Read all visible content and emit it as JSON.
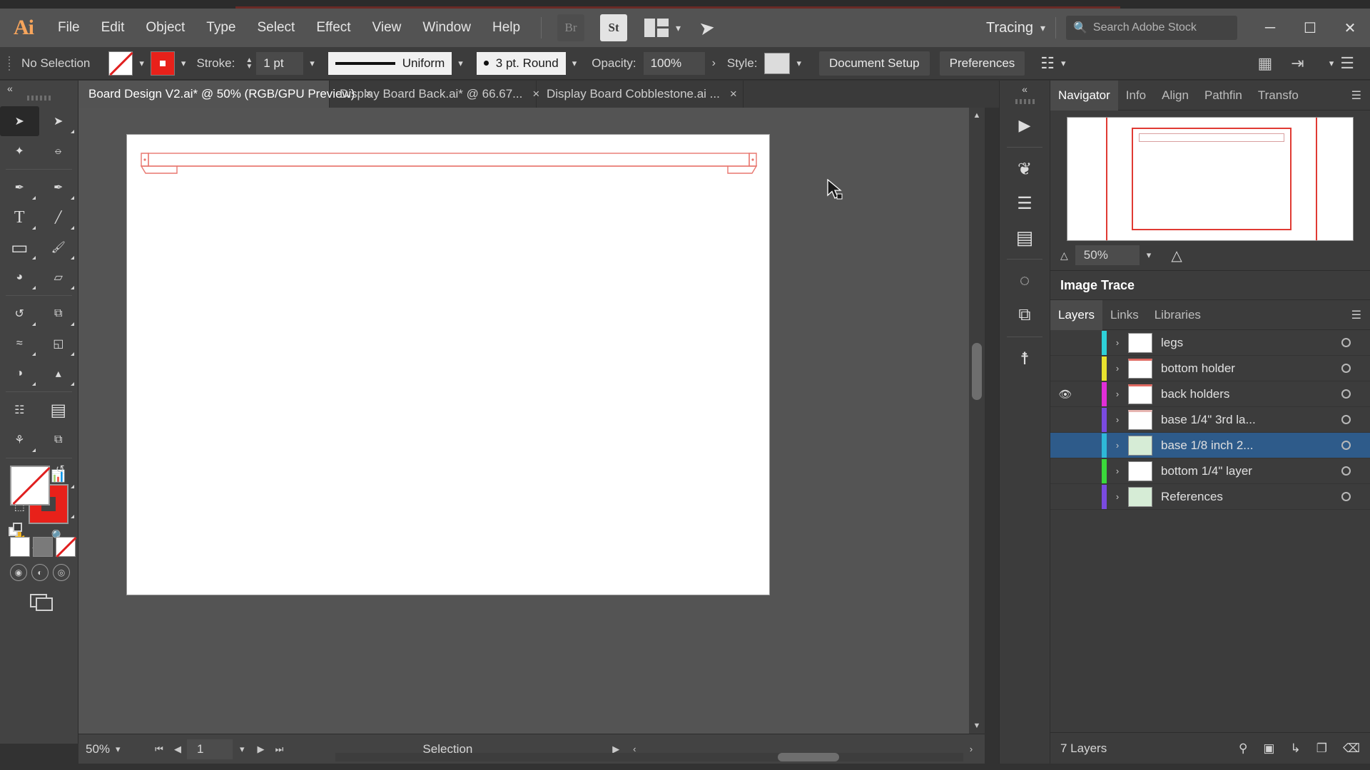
{
  "app": {
    "name": "Adobe Illustrator",
    "logo_text": "Ai"
  },
  "menubar": {
    "items": [
      {
        "label": "File"
      },
      {
        "label": "Edit"
      },
      {
        "label": "Object"
      },
      {
        "label": "Type"
      },
      {
        "label": "Select"
      },
      {
        "label": "Effect"
      },
      {
        "label": "View"
      },
      {
        "label": "Window"
      },
      {
        "label": "Help"
      }
    ],
    "bridge_label": "Br",
    "stock_label": "St",
    "arrange_icon": "arrange-documents-icon",
    "rocket_icon": "discover-rocket-icon",
    "workspace": "Tracing",
    "search_placeholder": "Search Adobe Stock",
    "search_value": "",
    "search_icon": "search-icon",
    "window_minimize": "minimize-icon",
    "window_restore": "restore-icon",
    "window_close": "close-icon"
  },
  "controlbar": {
    "selection_status": "No Selection",
    "fill_swatch": "none-swatch",
    "stroke_swatch": "red-stroke-swatch",
    "stroke_label": "Stroke:",
    "stroke_weight": "1 pt",
    "stroke_profile": "Uniform",
    "brush_definition": "3 pt. Round",
    "opacity_label": "Opacity:",
    "opacity_value": "100%",
    "style_label": "Style:",
    "document_setup": "Document Setup",
    "preferences": "Preferences",
    "align_icon": "align-icon",
    "distribute_icon": "distribute-icon",
    "transform_icon": "transform-icon",
    "arrange_icon": "arrange-objects-icon",
    "options_icon": "more-options-icon"
  },
  "tabs": [
    {
      "label": "Board Design V2.ai* @ 50% (RGB/GPU Preview)",
      "active": true,
      "close": "×"
    },
    {
      "label": "Display Board Back.ai* @ 66.67...",
      "active": false,
      "close": "×"
    },
    {
      "label": "Display Board Cobblestone.ai ...",
      "active": false,
      "close": "×"
    }
  ],
  "tools": [
    {
      "name": "selection-tool",
      "glyph": "➤",
      "active": true
    },
    {
      "name": "direct-selection-tool",
      "glyph": "➤",
      "active": false
    },
    {
      "name": "magic-wand-tool",
      "glyph": "✧",
      "active": false
    },
    {
      "name": "lasso-tool",
      "glyph": "⦵",
      "active": false
    },
    {
      "name": "pen-tool",
      "glyph": "✒",
      "active": false
    },
    {
      "name": "curvature-tool",
      "glyph": "∿",
      "active": false
    },
    {
      "name": "type-tool",
      "glyph": "T",
      "active": false
    },
    {
      "name": "line-segment-tool",
      "glyph": "╱",
      "active": false
    },
    {
      "name": "rectangle-tool",
      "glyph": "▭",
      "active": false
    },
    {
      "name": "paintbrush-tool",
      "glyph": "✐",
      "active": false
    },
    {
      "name": "shaper-tool",
      "glyph": "◔",
      "active": false
    },
    {
      "name": "eraser-tool",
      "glyph": "▱",
      "active": false
    },
    {
      "name": "rotate-tool",
      "glyph": "↺",
      "active": false
    },
    {
      "name": "scale-tool",
      "glyph": "⧉",
      "active": false
    },
    {
      "name": "width-tool",
      "glyph": "≈",
      "active": false
    },
    {
      "name": "free-transform-tool",
      "glyph": "◱",
      "active": false
    },
    {
      "name": "shape-builder-tool",
      "glyph": "◑",
      "active": false
    },
    {
      "name": "perspective-grid-tool",
      "glyph": "△",
      "active": false
    },
    {
      "name": "mesh-tool",
      "glyph": "⌗",
      "active": false
    },
    {
      "name": "gradient-tool",
      "glyph": "▤",
      "active": false
    },
    {
      "name": "eyedropper-tool",
      "glyph": "⚗",
      "active": false
    },
    {
      "name": "blend-tool",
      "glyph": "⧉",
      "active": false
    },
    {
      "name": "symbol-sprayer-tool",
      "glyph": "☃",
      "active": false
    },
    {
      "name": "column-graph-tool",
      "glyph": "█",
      "active": false
    },
    {
      "name": "artboard-tool",
      "glyph": "⬚",
      "active": false
    },
    {
      "name": "slice-tool",
      "glyph": "✂",
      "active": false
    },
    {
      "name": "hand-tool",
      "glyph": "✋",
      "active": false
    },
    {
      "name": "zoom-tool",
      "glyph": "⚲",
      "active": false
    }
  ],
  "toolpanel": {
    "collapse_icon": "«",
    "fill_proxy": "fill-color-none",
    "stroke_proxy": "stroke-color-red",
    "swap_icon": "swap-fill-stroke-icon",
    "default_icon": "default-fill-stroke-icon",
    "color_mode": "color-swatch-mode",
    "gradient_mode": "gradient-mode",
    "none_mode": "none-mode",
    "draw_normal": "draw-normal-icon",
    "draw_behind": "draw-behind-icon",
    "draw_inside": "draw-inside-icon",
    "screen_mode": "change-screen-mode-icon"
  },
  "statusbar": {
    "zoom_level": "50%",
    "first_page_icon": "⏮",
    "prev_page_icon": "◀",
    "page_value": "1",
    "next_page_icon": "▶",
    "last_page_icon": "⏭",
    "status_text": "Selection",
    "play_icon": "▶",
    "left_arrow": "‹",
    "right_arrow": "›"
  },
  "dockrail": {
    "collapse_icon": "«",
    "icons": [
      {
        "name": "properties-panel-icon",
        "glyph": "▶"
      },
      {
        "name": "brushes-panel-icon",
        "glyph": "❦"
      },
      {
        "name": "stroke-panel-icon",
        "glyph": "≡"
      },
      {
        "name": "gradient-panel-icon",
        "glyph": "▤"
      },
      {
        "name": "transparency-panel-icon",
        "glyph": "◌"
      },
      {
        "name": "pathfinder-panel-icon",
        "glyph": "⧉"
      },
      {
        "name": "image-trace-panel-icon",
        "glyph": "◨"
      }
    ]
  },
  "navigator": {
    "tabs": [
      {
        "label": "Navigator",
        "active": true
      },
      {
        "label": "Info",
        "active": false
      },
      {
        "label": "Align",
        "active": false
      },
      {
        "label": "Pathfin",
        "active": false
      },
      {
        "label": "Transfo",
        "active": false
      }
    ],
    "menu_icon": "panel-menu-icon",
    "zoom_out_icon": "zoom-out-icon",
    "zoom_value": "50%",
    "zoom_in_icon": "zoom-in-icon"
  },
  "image_trace": {
    "title": "Image Trace"
  },
  "layers_panel": {
    "tabs": [
      {
        "label": "Layers",
        "active": true
      },
      {
        "label": "Links",
        "active": false
      },
      {
        "label": "Libraries",
        "active": false
      }
    ],
    "menu_icon": "panel-menu-icon",
    "rows": [
      {
        "name": "legs",
        "color": "#2ed0d8",
        "visible": false,
        "selected": false,
        "expand": "›"
      },
      {
        "name": "bottom holder",
        "color": "#e8e22e",
        "visible": false,
        "selected": false,
        "expand": "›"
      },
      {
        "name": "back holders",
        "color": "#e22ed8",
        "visible": true,
        "selected": false,
        "expand": "›"
      },
      {
        "name": "base 1/4\" 3rd la...",
        "color": "#7a4ae0",
        "visible": false,
        "selected": false,
        "expand": "›"
      },
      {
        "name": "base 1/8 inch 2...",
        "color": "#2eb8d8",
        "visible": false,
        "selected": true,
        "expand": "›"
      },
      {
        "name": "bottom 1/4\" layer",
        "color": "#3ad83a",
        "visible": false,
        "selected": false,
        "expand": "›"
      },
      {
        "name": "References",
        "color": "#7a4ae0",
        "visible": false,
        "selected": false,
        "expand": "›"
      }
    ],
    "footer_count": "7 Layers",
    "footer_icons": [
      {
        "name": "locate-object-icon",
        "glyph": "⚲"
      },
      {
        "name": "make-clipping-mask-icon",
        "glyph": "◱"
      },
      {
        "name": "create-new-sublayer-icon",
        "glyph": "↳"
      },
      {
        "name": "create-new-layer-icon",
        "glyph": "❐"
      },
      {
        "name": "delete-selection-icon",
        "glyph": "Ὕ1"
      }
    ]
  },
  "canvas": {
    "artboard_color": "#ffffff",
    "shape_stroke": "#e8766e",
    "cursor_icon": "arrow-cursor"
  },
  "colors": {
    "accent_red": "#e8211a",
    "chrome_dark": "#3c3c3c",
    "chrome_mid": "#535353",
    "selection_blue": "#2e5b8a"
  }
}
